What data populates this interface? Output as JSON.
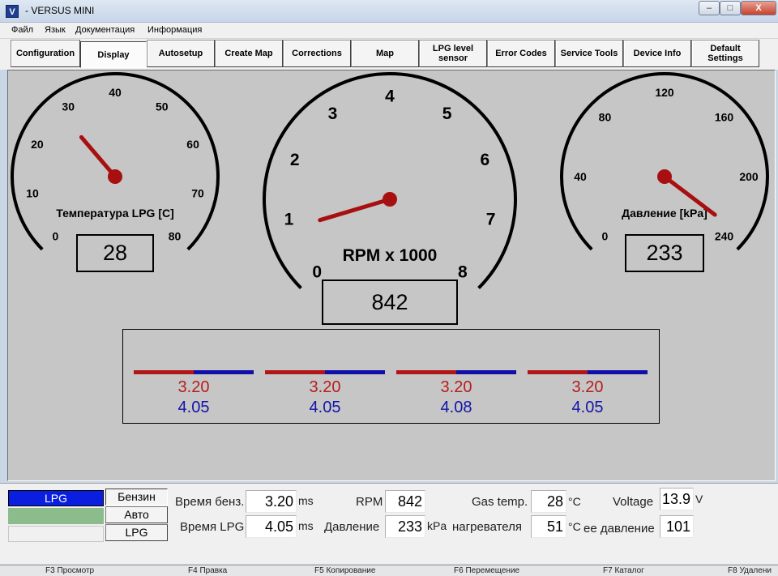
{
  "window": {
    "title": "- VERSUS MINI",
    "app_icon": "V",
    "controls": {
      "minimize": "–",
      "maximize": "□",
      "close": "X"
    }
  },
  "menu": [
    "Файл",
    "Язык",
    "Документация",
    "Информация"
  ],
  "tabs": [
    {
      "label": "Configuration"
    },
    {
      "label": "Display",
      "active": true
    },
    {
      "label": "Autosetup"
    },
    {
      "label": "Create Map"
    },
    {
      "label": "Corrections"
    },
    {
      "label": "Map"
    },
    {
      "label": "LPG level sensor"
    },
    {
      "label": "Error Codes"
    },
    {
      "label": "Service Tools"
    },
    {
      "label": "Device Info"
    },
    {
      "label": "Default Settings"
    }
  ],
  "gauges": {
    "temperature": {
      "label": "Температура LPG [C]",
      "ticks": [
        "0",
        "10",
        "20",
        "30",
        "40",
        "50",
        "60",
        "70",
        "80"
      ],
      "min": 0,
      "max": 80,
      "value": 28,
      "display": "28"
    },
    "rpm": {
      "label": "RPM x 1000",
      "ticks": [
        "0",
        "1",
        "2",
        "3",
        "4",
        "5",
        "6",
        "7",
        "8"
      ],
      "min": 0,
      "max": 8,
      "value": 0.842,
      "display": "842"
    },
    "pressure": {
      "label": "Давление [kPa]",
      "ticks": [
        "0",
        "40",
        "80",
        "120",
        "160",
        "200",
        "240"
      ],
      "min": 0,
      "max": 240,
      "value": 233,
      "display": "233"
    }
  },
  "injectors": [
    {
      "lpg": "3.20",
      "petrol": "4.05"
    },
    {
      "lpg": "3.20",
      "petrol": "4.05"
    },
    {
      "lpg": "3.20",
      "petrol": "4.08"
    },
    {
      "lpg": "3.20",
      "petrol": "4.05"
    }
  ],
  "mode": {
    "indicators": [
      "LPG",
      "",
      ""
    ],
    "indicator_colors": [
      "#0a1ee0",
      "#8cbc8c",
      "#f0f0f0"
    ],
    "buttons": [
      "Бензин",
      "Авто",
      "LPG"
    ]
  },
  "readouts": {
    "petrol_time": {
      "label": "Время бенз.",
      "value": "3.20",
      "unit": "ms"
    },
    "lpg_time": {
      "label": "Время LPG",
      "value": "4.05",
      "unit": "ms"
    },
    "rpm": {
      "label": "RPM",
      "value": "842",
      "unit": ""
    },
    "pressure": {
      "label": "Давление",
      "value": "233",
      "unit": "kPa"
    },
    "gas_temp": {
      "label": "Gas temp.",
      "value": "28",
      "unit": "°C"
    },
    "heater_temp": {
      "label": "нагревателя",
      "value": "51",
      "unit": "°C"
    },
    "voltage": {
      "label": "Voltage",
      "value": "13.9",
      "unit": "V"
    },
    "pressure2": {
      "label": "ее давление",
      "value": "101",
      "unit": ""
    }
  },
  "function_keys": [
    "F3 Просмотр",
    "F4 Правка",
    "F5 Копирование",
    "F6 Перемещение",
    "F7 Каталог",
    "F8 Удалени"
  ]
}
